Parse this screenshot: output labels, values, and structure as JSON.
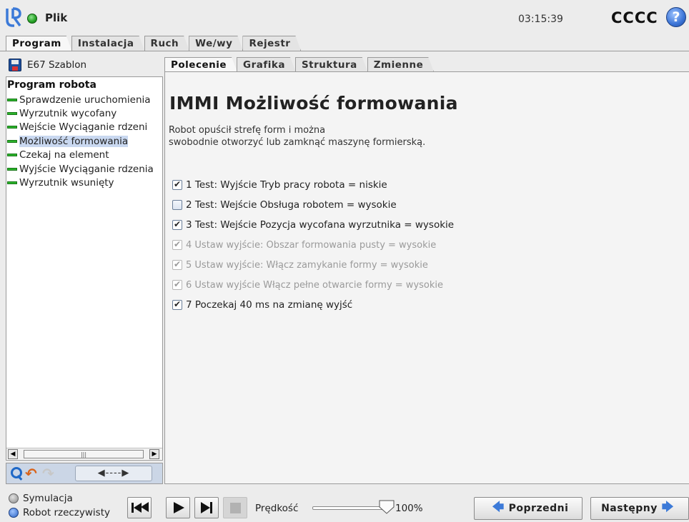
{
  "topbar": {
    "file_menu": "Plik",
    "clock": "03:15:39",
    "robot_name": "CCCC",
    "help": "?"
  },
  "main_tabs": [
    {
      "label": "Program",
      "active": true
    },
    {
      "label": "Instalacja",
      "active": false
    },
    {
      "label": "Ruch",
      "active": false
    },
    {
      "label": "We/wy",
      "active": false
    },
    {
      "label": "Rejestr",
      "active": false
    }
  ],
  "left": {
    "program_name": "E67 Szablon",
    "tree_root": "Program robota",
    "tree_items": [
      {
        "label": "Sprawdzenie uruchomienia",
        "selected": false
      },
      {
        "label": "Wyrzutnik wycofany",
        "selected": false
      },
      {
        "label": "Wejście Wyciąganie rdzeni",
        "selected": false
      },
      {
        "label": "Możliwość formowania",
        "selected": true
      },
      {
        "label": "Czekaj na element",
        "selected": false
      },
      {
        "label": "Wyjście Wyciąganie rdzenia",
        "selected": false
      },
      {
        "label": "Wyrzutnik wsunięty",
        "selected": false
      }
    ],
    "scroll_left": "◀",
    "scroll_thumb": "|||",
    "scroll_right": "▶",
    "move_label": "◀----▶"
  },
  "sub_tabs": [
    {
      "label": "Polecenie",
      "active": true
    },
    {
      "label": "Grafika",
      "active": false
    },
    {
      "label": "Struktura",
      "active": false
    },
    {
      "label": "Zmienne",
      "active": false
    }
  ],
  "content": {
    "title": "IMMI Możliwość formowania",
    "desc_line1": "Robot opuścił strefę form i można",
    "desc_line2": "swobodnie otworzyć lub zamknąć maszynę formierską.",
    "checks": [
      {
        "label": "1 Test: Wyjście Tryb pracy robota = niskie",
        "checked": true,
        "enabled": true
      },
      {
        "label": "2 Test: Wejście Obsługa robotem = wysokie",
        "checked": false,
        "enabled": true
      },
      {
        "label": "3 Test: Wejście Pozycja wycofana wyrzutnika = wysokie",
        "checked": true,
        "enabled": true
      },
      {
        "label": "4 Ustaw wyjście: Obszar formowania pusty = wysokie",
        "checked": true,
        "enabled": false
      },
      {
        "label": "5 Ustaw wyjście: Włącz zamykanie formy = wysokie",
        "checked": true,
        "enabled": false
      },
      {
        "label": "6 Ustaw wyjście Włącz pełne otwarcie formy = wysokie",
        "checked": true,
        "enabled": false
      },
      {
        "label": "7 Poczekaj 40 ms na zmianę wyjść",
        "checked": true,
        "enabled": true
      }
    ]
  },
  "bottom": {
    "mode_sim": "Symulacja",
    "mode_real": "Robot rzeczywisty",
    "speed_label": "Prędkość",
    "speed_value": "100%",
    "speed_fraction": 1.0,
    "prev_label": "Poprzedni",
    "next_label": "Następny"
  },
  "colors": {
    "accent": "#3c7ad8",
    "status_ok": "#2aa52a",
    "selection": "#c9d8f0"
  }
}
